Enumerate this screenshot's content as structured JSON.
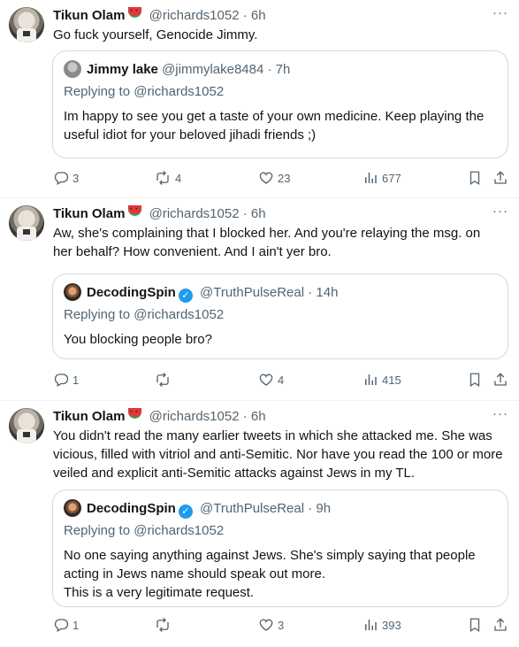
{
  "tweets": [
    {
      "author": "Tikun Olam",
      "handle": "@richards1052",
      "time": "· 6h",
      "more": "···",
      "text": "Go fuck yourself, Genocide Jimmy.",
      "quote": {
        "author": "Jimmy lake",
        "handle": "@jimmylake8484",
        "time": "· 7h",
        "reply": "Replying to @richards1052",
        "text": "Im happy to see you get a taste of your own medicine. Keep playing the useful idiot for your beloved jihadi friends ;)"
      },
      "stats": {
        "replies": "3",
        "reposts": "4",
        "likes": "23",
        "views": "677"
      }
    },
    {
      "author": "Tikun Olam",
      "handle": "@richards1052",
      "time": "· 6h",
      "more": "···",
      "text": "Aw, she's complaining that I blocked her. And you're relaying the msg. on her behalf? How convenient. And I ain't yer bro.",
      "quote": {
        "author": "DecodingSpin",
        "handle": "@TruthPulseReal",
        "time": "· 14h",
        "reply": "Replying to @richards1052",
        "text": "You blocking people bro?"
      },
      "stats": {
        "replies": "1",
        "reposts": "",
        "likes": "4",
        "views": "415"
      }
    },
    {
      "author": "Tikun Olam",
      "handle": "@richards1052",
      "time": "· 6h",
      "more": "···",
      "text": "You didn't read the many earlier tweets in which she attacked me.  She was vicious, filled with vitriol and anti-Semitic. Nor have you read the 100 or more veiled and explicit anti-Semitic attacks against Jews in my TL.",
      "quote": {
        "author": "DecodingSpin",
        "handle": "@TruthPulseReal",
        "time": "· 9h",
        "reply": "Replying to @richards1052",
        "text": "No one saying anything against Jews. She's simply saying that people acting in Jews name should speak out more.\nThis is a very legitimate request."
      },
      "stats": {
        "replies": "1",
        "reposts": "",
        "likes": "3",
        "views": "393"
      }
    }
  ]
}
